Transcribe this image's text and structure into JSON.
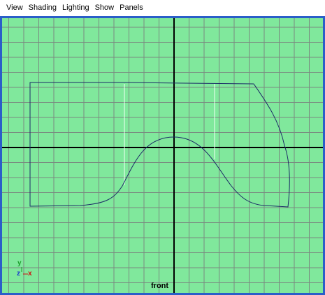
{
  "menu": {
    "items": [
      "View",
      "Shading",
      "Lighting",
      "Show",
      "Panels"
    ]
  },
  "viewport": {
    "camera_label": "front",
    "background_color": "#80e89c",
    "grid_color": "#7a8a80",
    "axis_color": "#000000",
    "curve_color": "#1a2a66",
    "frame_color": "#2a5ec9"
  },
  "axis_indicator": {
    "y_label": "y",
    "z_label": "z",
    "x_label": "x",
    "y_color": "#1b9e2c",
    "z_color": "#1a3acc",
    "x_color": "#d01010"
  }
}
